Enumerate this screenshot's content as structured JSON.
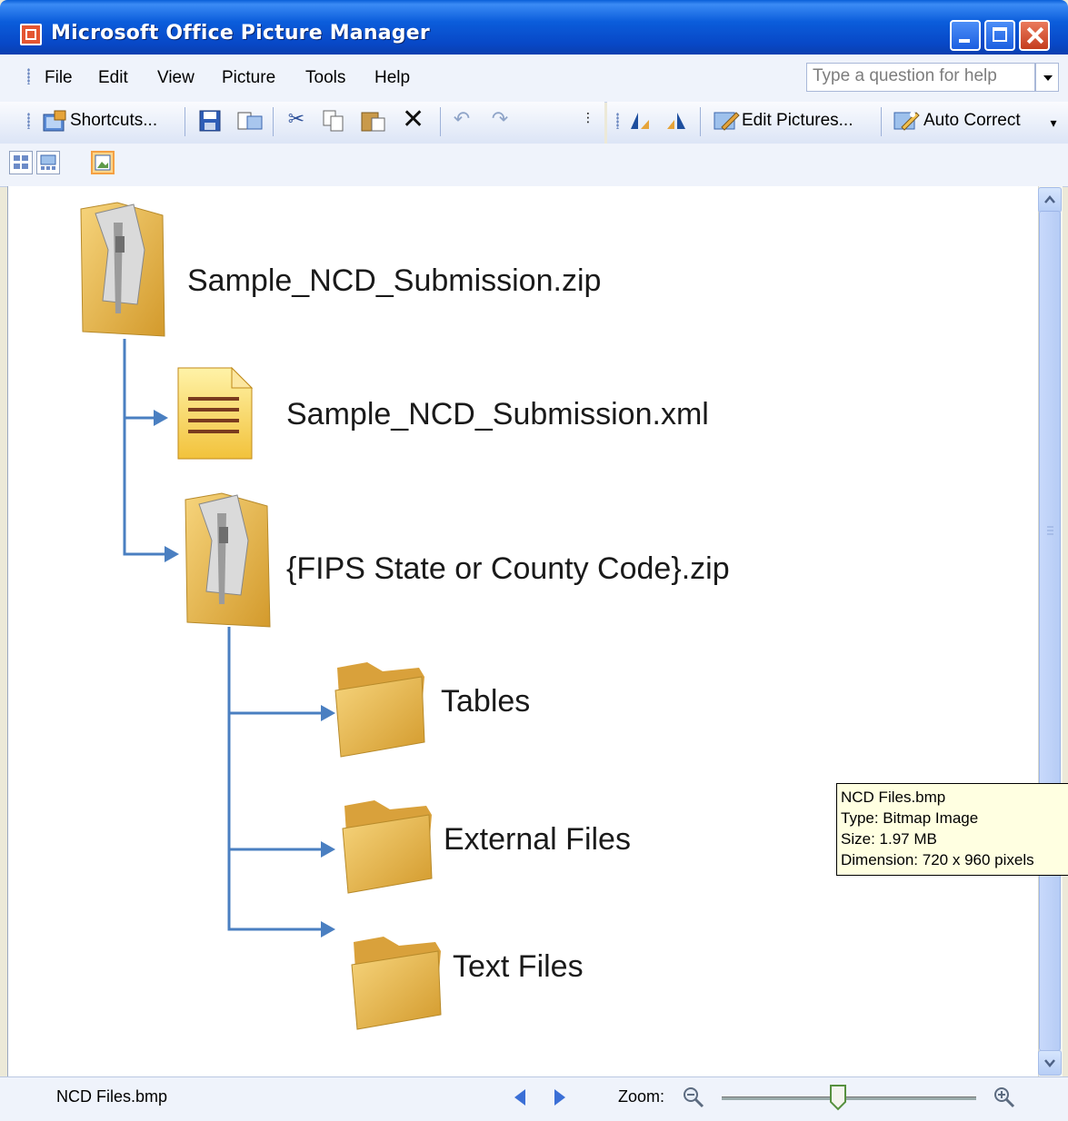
{
  "window": {
    "title": "Microsoft Office Picture Manager"
  },
  "menu": {
    "items": [
      "File",
      "Edit",
      "View",
      "Picture",
      "Tools",
      "Help"
    ],
    "help_placeholder": "Type a question for help"
  },
  "toolbar": {
    "shortcuts_label": "Shortcuts...",
    "edit_pictures_label": "Edit Pictures...",
    "auto_correct_label": "Auto Correct"
  },
  "diagram": {
    "root_zip": "Sample_NCD_Submission.zip",
    "xml_file": "Sample_NCD_Submission.xml",
    "state_zip": "{FIPS State or County Code}.zip",
    "folders": [
      "Tables",
      "External Files",
      "Text Files"
    ]
  },
  "tooltip": {
    "name": "NCD Files.bmp",
    "type": "Type: Bitmap Image",
    "size": "Size: 1.97 MB",
    "dimension": "Dimension: 720 x 960 pixels"
  },
  "status": {
    "filename": "NCD Files.bmp",
    "zoom_label": "Zoom:"
  },
  "colors": {
    "titlebar": "#0A5FD8",
    "connector": "#4A7FC1",
    "folder": "#E8B84A"
  }
}
